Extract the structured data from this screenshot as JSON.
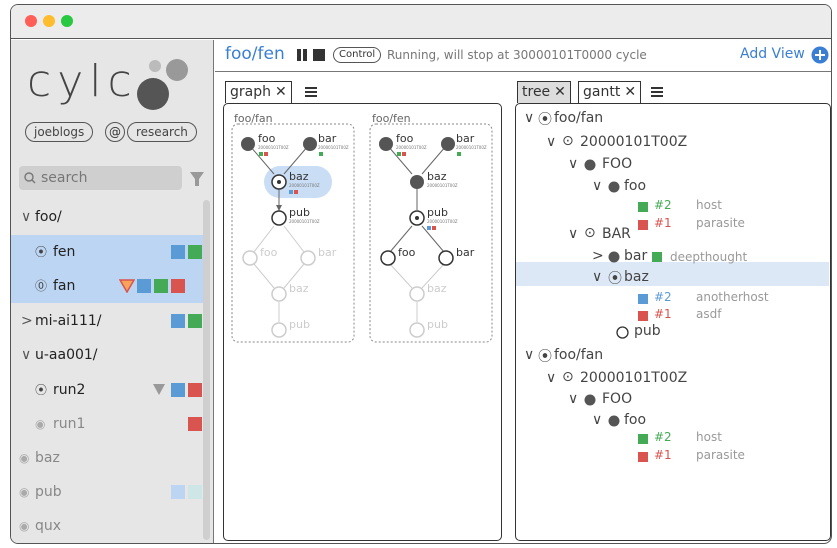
{
  "colors": {
    "blue": "#5b9bd5",
    "green": "#44aa55",
    "red": "#d9534f",
    "select": "#bcd5f2",
    "accent": "#3a7fd4"
  },
  "logo": "cylc",
  "user": "joeblogs",
  "at": "@",
  "host": "research",
  "search": {
    "placeholder": "search"
  },
  "sidebar": {
    "items": [
      {
        "label": "foo/"
      },
      {
        "label": "fen"
      },
      {
        "label": "fan"
      },
      {
        "label": "mi-ai111/"
      },
      {
        "label": "u-aa001/"
      },
      {
        "label": "run2"
      },
      {
        "label": "run1"
      },
      {
        "label": "baz"
      },
      {
        "label": "pub"
      },
      {
        "label": "qux"
      }
    ]
  },
  "header": {
    "workflow": "foo/fen",
    "control": "Control",
    "status": "Running, will stop at 30000101T0000 cycle",
    "add_view": "Add View"
  },
  "graph_panel": {
    "tab": "graph",
    "workflows": [
      "foo/fan",
      "foo/fen"
    ],
    "nodes": {
      "foo": "foo",
      "bar": "bar",
      "baz": "baz",
      "pub": "pub"
    },
    "cycle": "20000101T00Z"
  },
  "tree_panel": {
    "tabs": [
      "tree",
      "gantt"
    ],
    "rows": [
      {
        "text": "foo/fan"
      },
      {
        "text": "20000101T00Z"
      },
      {
        "text": "FOO"
      },
      {
        "text": "foo"
      },
      {
        "text": "#2",
        "extra": "host"
      },
      {
        "text": "#1",
        "extra": "parasite"
      },
      {
        "text": "BAR"
      },
      {
        "text": "bar",
        "extra": "deepthought"
      },
      {
        "text": "baz"
      },
      {
        "text": "#2",
        "extra": "anotherhost"
      },
      {
        "text": "#1",
        "extra": "asdf"
      },
      {
        "text": "pub"
      },
      {
        "text": "foo/fan"
      },
      {
        "text": "20000101T00Z"
      },
      {
        "text": "FOO"
      },
      {
        "text": "foo"
      },
      {
        "text": "#2",
        "extra": "host"
      },
      {
        "text": "#1",
        "extra": "parasite"
      }
    ]
  }
}
